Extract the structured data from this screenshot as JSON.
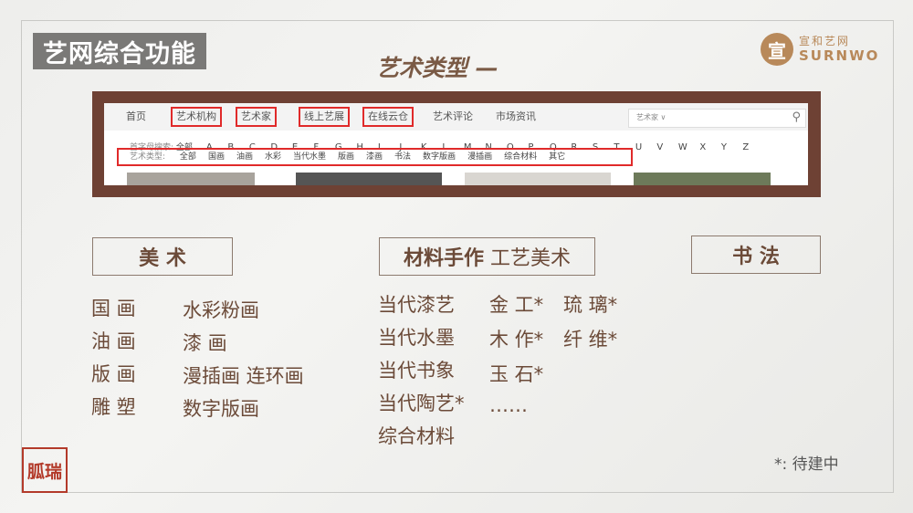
{
  "title": "艺网综合功能",
  "subtitle": "艺术类型 —",
  "logo": {
    "seal": "宣",
    "cn": "宣和艺网",
    "en": "SURNWO"
  },
  "website": {
    "nav": [
      "首页",
      "艺术机构",
      "艺术家",
      "线上艺展",
      "在线云仓",
      "艺术评论",
      "市场资讯"
    ],
    "search_placeholder": "艺术家 ∨",
    "alpha_label": "首字母搜索:",
    "alpha_all": "全部",
    "letters": [
      "A",
      "B",
      "C",
      "D",
      "E",
      "F",
      "G",
      "H",
      "I",
      "J",
      "K",
      "L",
      "M",
      "N",
      "O",
      "P",
      "Q",
      "R",
      "S",
      "T",
      "U",
      "V",
      "W",
      "X",
      "Y",
      "Z"
    ],
    "type_label": "艺术类型:",
    "types": [
      "全部",
      "国画",
      "油画",
      "水彩",
      "当代水墨",
      "版画",
      "漆画",
      "书法",
      "数字版画",
      "漫插画",
      "综合材料",
      "其它"
    ]
  },
  "sections": {
    "fine_art": {
      "header": "美 术",
      "col1": [
        "国 画",
        "油 画",
        "版 画",
        "雕 塑"
      ],
      "col2": [
        "水彩粉画",
        "漆 画",
        "漫插画 连环画",
        "数字版画"
      ]
    },
    "craft": {
      "header_bold": "材料手作",
      "header_rest": " 工艺美术",
      "col1": [
        "当代漆艺",
        "当代水墨",
        "当代书象",
        "当代陶艺*",
        "综合材料"
      ],
      "col2": [
        "金 工*",
        "木 作*",
        "玉 石*",
        "……"
      ],
      "col3": [
        "琉 璃*",
        "纤 维*"
      ]
    },
    "calligraphy": {
      "header": "书 法"
    }
  },
  "note": "*: 待建中",
  "stamp": "胍瑞"
}
